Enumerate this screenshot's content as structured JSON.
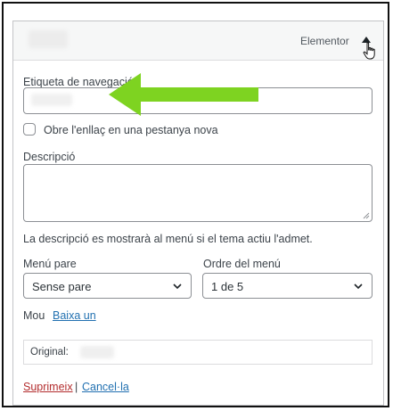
{
  "menu_item": {
    "type": "Elementor",
    "nav_label": {
      "label": "Etiqueta de navegació",
      "value": ""
    },
    "open_new_tab": {
      "label": "Obre l'enllaç en una pestanya nova",
      "checked": false
    },
    "description": {
      "label": "Descripció",
      "value": "",
      "help": "La descripció es mostrarà al menú si el tema actiu l'admet."
    },
    "parent_menu": {
      "label": "Menú pare",
      "value": "Sense pare"
    },
    "menu_order": {
      "label": "Ordre del menú",
      "value": "1 de 5"
    },
    "move": {
      "label": "Mou",
      "down_link": "Baixa un"
    },
    "original": {
      "label": "Original:"
    },
    "actions": {
      "remove": "Suprimeix",
      "separator": "|",
      "cancel": "Cancel·la"
    }
  },
  "colors": {
    "accent_link": "#2271b1",
    "danger_link": "#b32d2e",
    "annotation_arrow": "#7ed321"
  },
  "icons": {
    "toggle": "triangle-up-icon",
    "cursor": "hand-pointer-icon",
    "select_arrow": "chevron-down-icon",
    "annotation": "green-arrow-icon"
  }
}
